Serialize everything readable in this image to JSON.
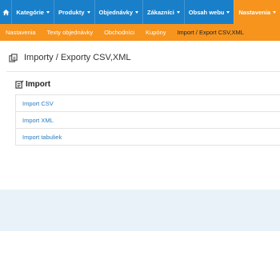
{
  "nav": {
    "items": [
      {
        "label": "Kategórie"
      },
      {
        "label": "Produkty"
      },
      {
        "label": "Objednávky"
      },
      {
        "label": "Zákazníci"
      },
      {
        "label": "Obsah webu"
      },
      {
        "label": "Nastavenia"
      }
    ],
    "active_index": 5
  },
  "subnav": {
    "items": [
      {
        "label": "Nastavenia"
      },
      {
        "label": "Texty objednávky"
      },
      {
        "label": "Obchodníci"
      },
      {
        "label": "Kupóny"
      },
      {
        "label": "Import / Export CSV,XML"
      }
    ],
    "active_index": 4
  },
  "page": {
    "title": "Importy / Exporty CSV,XML",
    "title_icon": "import-export-icon"
  },
  "section": {
    "title": "Import",
    "icon": "import-icon",
    "links": [
      {
        "label": "Import CSV"
      },
      {
        "label": "Import XML"
      },
      {
        "label": "Import tabuliek"
      }
    ]
  },
  "colors": {
    "nav_bg": "#1a7fc9",
    "accent": "#f7941d",
    "link": "#2b7bbf",
    "footer": "#e8f2f8"
  }
}
